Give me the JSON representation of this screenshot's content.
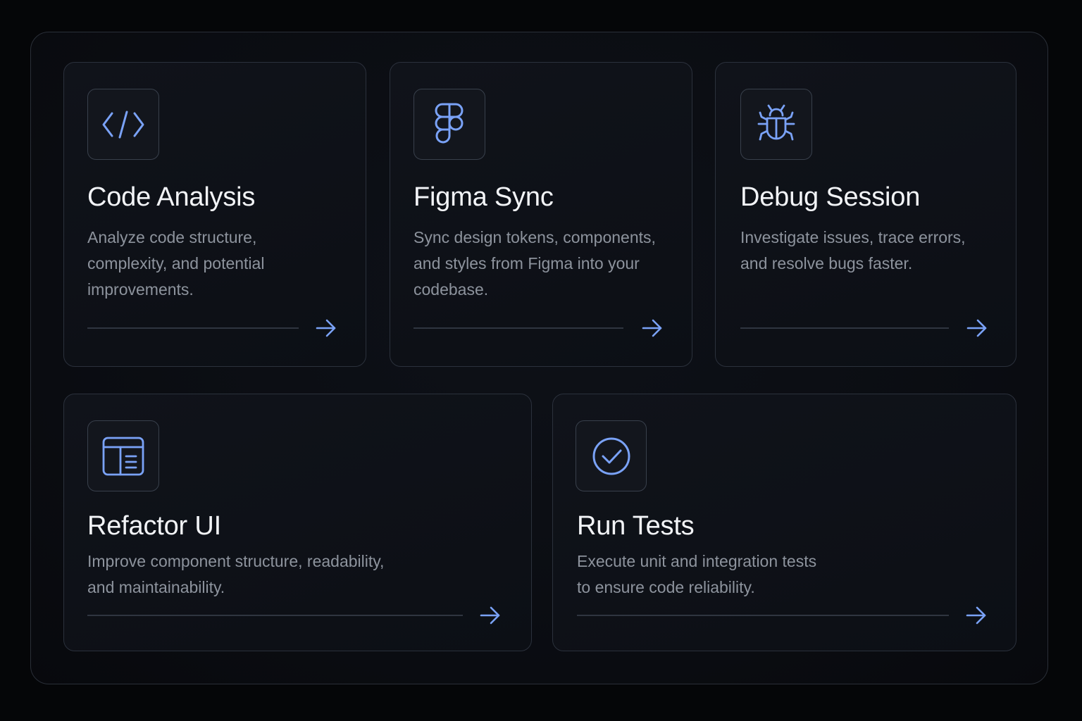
{
  "accent_color": "#7aa2f7",
  "cards": [
    {
      "icon": "code-icon",
      "title": "Code Analysis",
      "description": "Analyze code structure,\ncomplexity, and potential\nimprovements."
    },
    {
      "icon": "figma-icon",
      "title": "Figma Sync",
      "description": "Sync design tokens, components,\nand styles from Figma into your\ncodebase."
    },
    {
      "icon": "bug-icon",
      "title": "Debug Session",
      "description": "Investigate issues, trace errors,\nand resolve bugs faster."
    },
    {
      "icon": "layout-icon",
      "title": "Refactor UI",
      "description": "Improve component structure, readability,\nand maintainability."
    },
    {
      "icon": "check-circle-icon",
      "title": "Run Tests",
      "description": "Execute unit and integration tests\nto ensure code reliability."
    }
  ]
}
